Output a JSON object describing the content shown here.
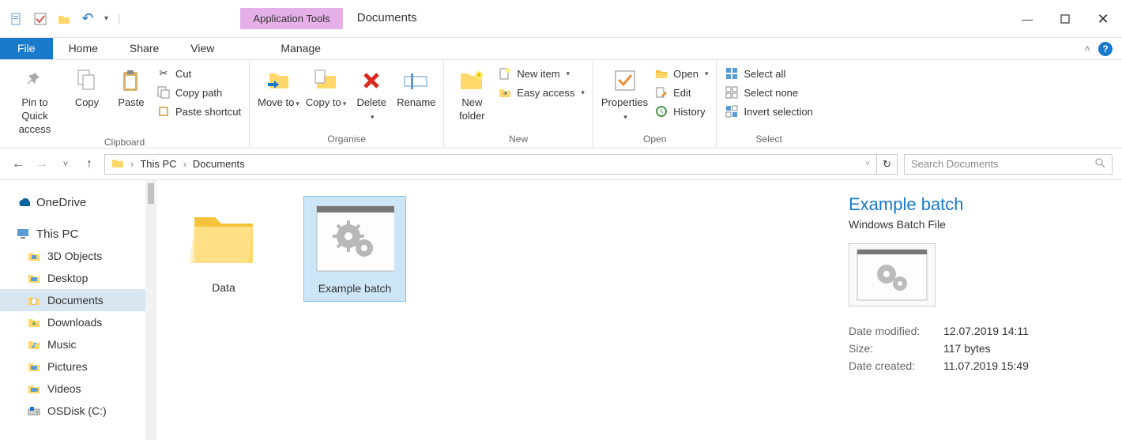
{
  "window": {
    "contextual_tab": "Application Tools",
    "title": "Documents"
  },
  "tabs": {
    "file": "File",
    "home": "Home",
    "share": "Share",
    "view": "View",
    "manage": "Manage"
  },
  "ribbon": {
    "clipboard": {
      "label": "Clipboard",
      "pin": "Pin to Quick access",
      "copy": "Copy",
      "paste": "Paste",
      "cut": "Cut",
      "copy_path": "Copy path",
      "paste_shortcut": "Paste shortcut"
    },
    "organise": {
      "label": "Organise",
      "move_to": "Move to",
      "copy_to": "Copy to",
      "delete": "Delete",
      "rename": "Rename"
    },
    "new": {
      "label": "New",
      "new_folder": "New folder",
      "new_item": "New item",
      "easy_access": "Easy access"
    },
    "open": {
      "label": "Open",
      "properties": "Properties",
      "open": "Open",
      "edit": "Edit",
      "history": "History"
    },
    "select": {
      "label": "Select",
      "select_all": "Select all",
      "select_none": "Select none",
      "invert": "Invert selection"
    }
  },
  "address": {
    "root": "This PC",
    "current": "Documents"
  },
  "search": {
    "placeholder": "Search Documents"
  },
  "nav": {
    "onedrive": "OneDrive",
    "thispc": "This PC",
    "items": [
      "3D Objects",
      "Desktop",
      "Documents",
      "Downloads",
      "Music",
      "Pictures",
      "Videos",
      "OSDisk (C:)"
    ]
  },
  "files": [
    {
      "name": "Data",
      "type": "folder"
    },
    {
      "name": "Example batch",
      "type": "batch",
      "selected": true
    }
  ],
  "details": {
    "name": "Example batch",
    "type": "Windows Batch File",
    "rows": [
      {
        "label": "Date modified:",
        "value": "12.07.2019 14:11"
      },
      {
        "label": "Size:",
        "value": "117 bytes"
      },
      {
        "label": "Date created:",
        "value": "11.07.2019 15:49"
      }
    ]
  }
}
